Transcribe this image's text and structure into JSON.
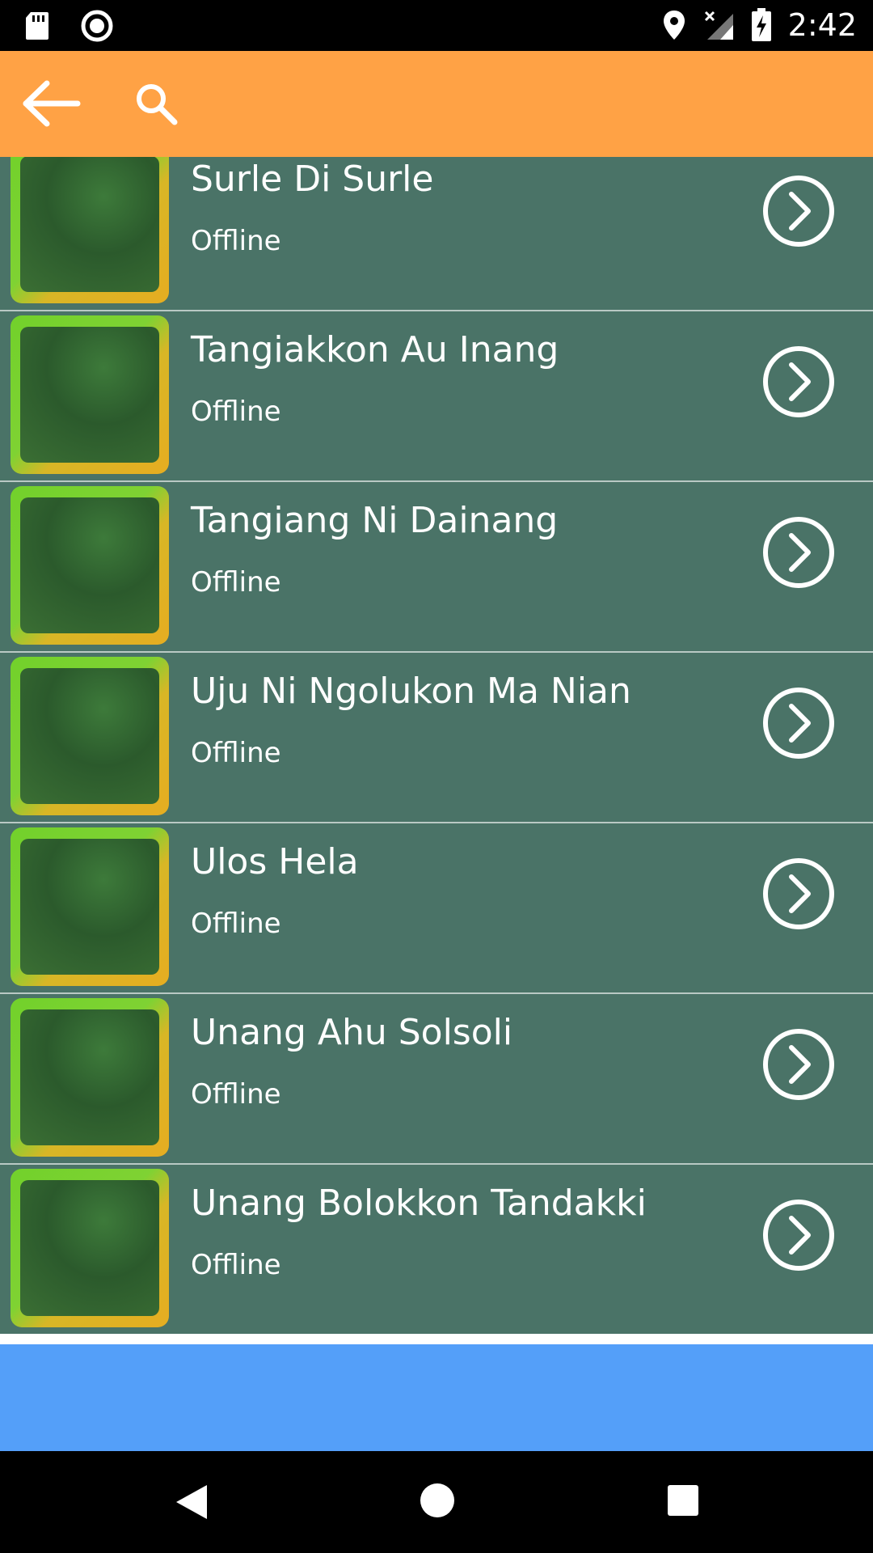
{
  "status_bar": {
    "time": "2:42",
    "icons": [
      "sd-card-icon",
      "recording-icon",
      "location-icon",
      "no-signal-icon",
      "battery-charging-icon"
    ]
  },
  "app_bar": {
    "back_icon": "arrow-left-icon",
    "search_icon": "search-icon",
    "color": "#ffa245"
  },
  "songs": [
    {
      "title": "Surle Di Surle",
      "status": "Offline"
    },
    {
      "title": "Tangiakkon Au Inang",
      "status": "Offline"
    },
    {
      "title": "Tangiang Ni Dainang",
      "status": "Offline"
    },
    {
      "title": "Uju Ni Ngolukon Ma Nian",
      "status": "Offline"
    },
    {
      "title": "Ulos Hela",
      "status": "Offline"
    },
    {
      "title": "Unang Ahu Solsoli",
      "status": "Offline"
    },
    {
      "title": "Unang Bolokkon Tandakki",
      "status": "Offline"
    }
  ],
  "colors": {
    "list_row": "#4a7367",
    "ad_banner": "#549ff9"
  },
  "nav_bar": {
    "icons": [
      "back-triangle-icon",
      "home-circle-icon",
      "recents-square-icon"
    ]
  }
}
